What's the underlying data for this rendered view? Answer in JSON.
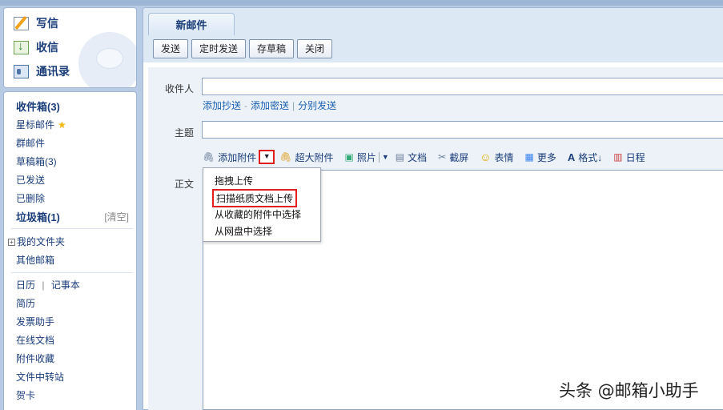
{
  "sidebar_actions": {
    "write": "写信",
    "inbox": "收信",
    "contacts": "通讯录"
  },
  "sidebar": {
    "inbox": "收件箱(3)",
    "starred": "星标邮件",
    "group": "群邮件",
    "drafts": "草稿箱(3)",
    "sent": "已发送",
    "deleted": "已删除",
    "spam": "垃圾箱(1)",
    "spam_clear": "[清空]",
    "my_folders": "我的文件夹",
    "other_mailboxes": "其他邮箱",
    "calendar": "日历",
    "divider": "|",
    "notebook": "记事本",
    "resume": "简历",
    "invoice": "发票助手",
    "online_docs": "在线文档",
    "attachment_fav": "附件收藏",
    "transfer": "文件中转站",
    "cards": "贺卡"
  },
  "tab": {
    "title": "新邮件"
  },
  "toolbar": {
    "send": "发送",
    "timed_send": "定时发送",
    "save_draft": "存草稿",
    "close": "关闭"
  },
  "compose": {
    "recipient_label": "收件人",
    "recipient_value": "",
    "cc_link": "添加抄送",
    "cc_sep": "-",
    "bcc_link": "添加密送",
    "sep": "|",
    "separate_link": "分别发送",
    "subject_label": "主题",
    "subject_value": "",
    "body_label": "正文"
  },
  "attach_bar": {
    "add_attachment": "添加附件",
    "super_attachment": "超大附件",
    "photo": "照片",
    "document": "文档",
    "screenshot": "截屏",
    "emoji": "表情",
    "more": "更多",
    "format": "格式↓",
    "schedule": "日程"
  },
  "attach_menu": {
    "items": [
      "拖拽上传",
      "扫描纸质文档上传",
      "从收藏的附件中选择",
      "从网盘中选择"
    ],
    "highlighted_index": 1
  },
  "watermark": "头条 @邮箱小助手",
  "colors": {
    "highlight_red": "#e02020",
    "link_blue": "#1a5fb4",
    "nav_text": "#1a3d7a"
  }
}
